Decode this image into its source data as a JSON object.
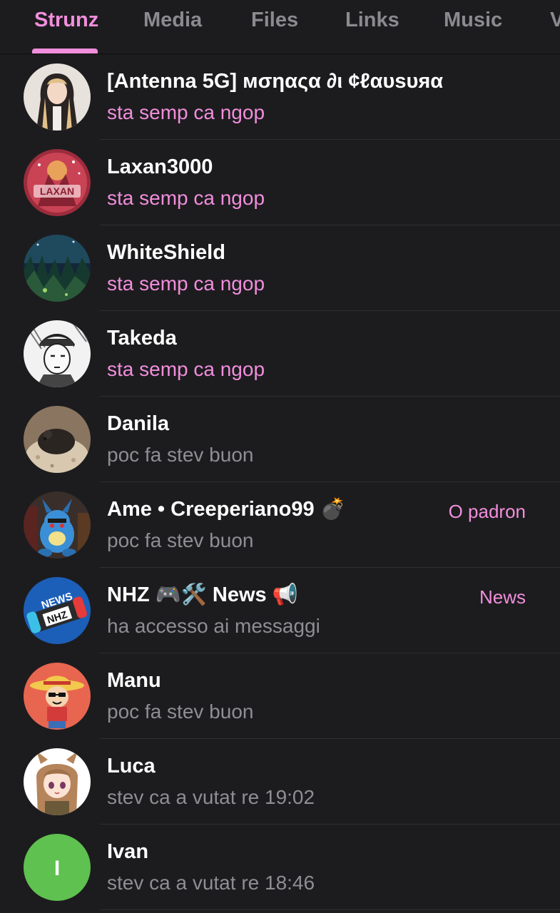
{
  "tabs": [
    {
      "label": "Strunz",
      "active": true
    },
    {
      "label": "Media",
      "active": false
    },
    {
      "label": "Files",
      "active": false
    },
    {
      "label": "Links",
      "active": false
    },
    {
      "label": "Music",
      "active": false
    },
    {
      "label": "V",
      "active": false
    }
  ],
  "colors": {
    "accent": "#f18edc",
    "background": "#1c1c1e",
    "text_primary": "#ffffff",
    "text_secondary": "#8e8e93"
  },
  "members": [
    {
      "name": "[Antenna 5G] мσηαςα ∂ι ¢ℓαυѕυяα",
      "status": "sta semp ca ngop",
      "online": true,
      "rank": "",
      "avatar": "anime-nun-avatar"
    },
    {
      "name": "Laxan3000",
      "status": "sta semp ca ngop",
      "online": true,
      "rank": "",
      "avatar": "laxan-logo-avatar"
    },
    {
      "name": "WhiteShield",
      "status": "sta semp ca ngop",
      "online": true,
      "rank": "",
      "avatar": "forest-night-avatar"
    },
    {
      "name": "Takeda",
      "status": "sta semp ca ngop",
      "online": true,
      "rank": "",
      "avatar": "manga-boy-avatar"
    },
    {
      "name": "Danila",
      "status": "poc fa stev buon",
      "online": false,
      "rank": "",
      "avatar": "hamster-avatar"
    },
    {
      "name": "Ame • Creeperiano99 💣",
      "status": "poc fa stev buon",
      "online": false,
      "rank": "O padron",
      "avatar": "blue-plush-avatar"
    },
    {
      "name": "NHZ 🎮🛠️ News 📢",
      "status": "ha accesso ai messaggi",
      "online": false,
      "rank": "News",
      "avatar": "nhz-news-logo-avatar"
    },
    {
      "name": "Manu",
      "status": "poc fa stev buon",
      "online": false,
      "rank": "",
      "avatar": "straw-hat-chibi-avatar"
    },
    {
      "name": "Luca",
      "status": "stev ca a vutat re 19:02",
      "online": false,
      "rank": "",
      "avatar": "anime-girl-avatar"
    },
    {
      "name": "Ivan",
      "status": "stev ca a vutat re 18:46",
      "online": false,
      "rank": "",
      "avatar": "letter-avatar",
      "initial": "I",
      "avatar_color": "#5fc14f"
    }
  ]
}
